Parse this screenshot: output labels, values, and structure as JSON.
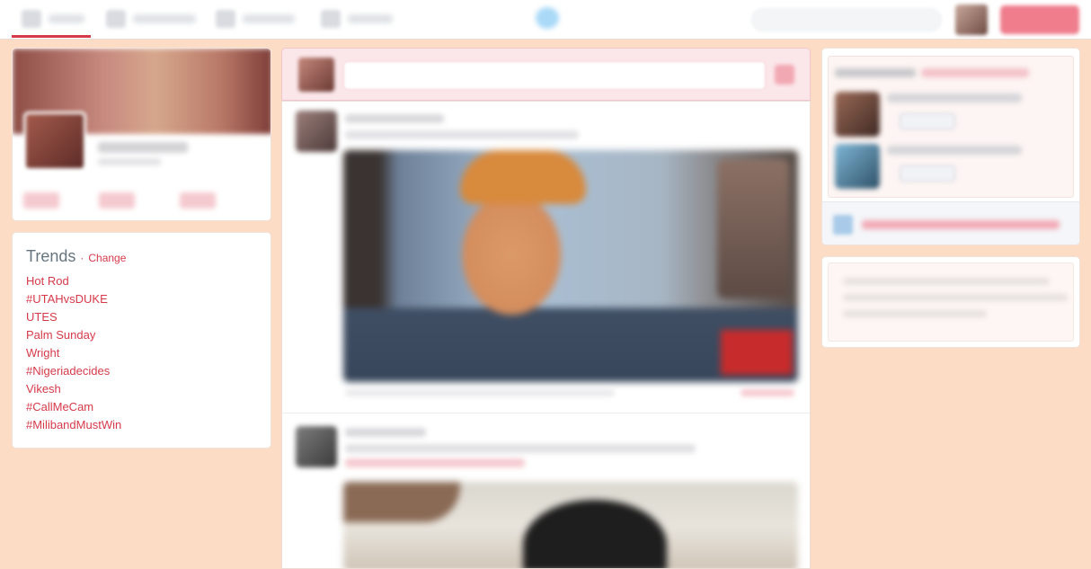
{
  "trends": {
    "title": "Trends",
    "separator": "·",
    "change_label": "Change",
    "items": [
      "Hot Rod",
      "#UTAHvsDUKE",
      "UTES",
      "Palm Sunday",
      "Wright",
      "#Nigeriadecides",
      "Vikesh",
      "#CallMeCam",
      "#MilibandMustWin"
    ]
  },
  "nav": {
    "items": [
      "home",
      "notifications",
      "messages",
      "discover"
    ],
    "active_index": 0
  },
  "icons": {
    "logo": "bird-icon",
    "compose": "camera-icon"
  },
  "colors": {
    "page_background": "#fddcc6",
    "accent": "#d63a4a",
    "trend_title": "#66757f",
    "card_background": "#ffffff"
  }
}
